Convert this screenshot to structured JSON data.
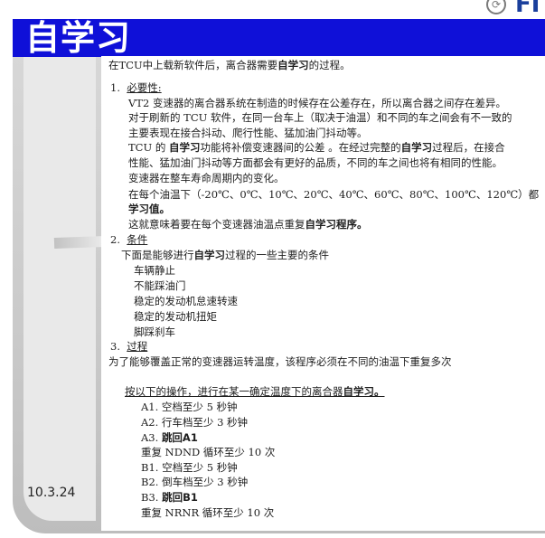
{
  "brand": {
    "text": "FI"
  },
  "header": {
    "title": "自学习"
  },
  "footer": {
    "date": "10.3.24"
  },
  "content": {
    "intro": {
      "a": "在TCU中上载新软件后，离合器需要",
      "b": "自学习",
      "c": "的过程。"
    },
    "section1": {
      "num": "1.",
      "heading": "必要性:",
      "p1": "VT2 变速器的离合器系统在制造的时候存在公差存在，所以离合器之间存在差异。",
      "p2": "对于刷新的 TCU 软件，在同一台车上（取决于油温）和不同的车之间会有不一致的",
      "p3": "主要表现在接合抖动、爬行性能、猛加油门抖动等。",
      "p4a": "TCU 的 ",
      "p4b": "自学习",
      "p4c": "功能将补偿变速器间的公差 。在经过完整的",
      "p4d": "自学习",
      "p4e": "过程后，在接合",
      "p5": "性能、猛加油门抖动等方面都会有更好的品质，不同的车之间也将有相同的性能。",
      "p6": "变速器在整车寿命周期内的变化。",
      "p7": "在每个油温下（-20℃、0℃、10℃、20℃、40℃、60℃、80℃、100℃、120℃）都",
      "p8": "学习值。",
      "p9a": "这就意味着要在每个变速器油温点重复",
      "p9b": "自学习程序。"
    },
    "section2": {
      "num": "2.",
      "heading": "条件",
      "introA": "下面是能够进行",
      "introB": "自学习",
      "introC": "过程的一些主要的条件",
      "items": [
        "车辆静止",
        "不能踩油门",
        "稳定的发动机怠速转速",
        "稳定的发动机扭矩",
        "脚踩刹车"
      ]
    },
    "section3": {
      "num": "3.",
      "heading": "过程",
      "p1": "为了能够覆盖正常的变速器运转温度，该程序必须在不同的油温下重复多次",
      "stepsIntroA": "按以下的操作，进行在某一确定温度下的离合器",
      "stepsIntroB": "自学习。",
      "steps": [
        {
          "a": "A1. 空档至少 5 秒钟",
          "b": ""
        },
        {
          "a": "A2. 行车档至少 3 秒钟",
          "b": ""
        },
        {
          "a": "A3. ",
          "b": "跳回A1"
        },
        {
          "a": "重复 NDND 循环至少 10 次",
          "b": ""
        },
        {
          "a": "B1. 空档至少 5 秒钟",
          "b": ""
        },
        {
          "a": "B2. 倒车档至少 3 秒钟",
          "b": ""
        },
        {
          "a": "B3. ",
          "b": "跳回B1"
        },
        {
          "a": "重复 NRNR 循环至少 10 次",
          "b": ""
        }
      ]
    }
  },
  "colors": {
    "title_bar": "#0f10d8",
    "brand": "#1a3f9c",
    "frame": "#c9c9c9"
  }
}
